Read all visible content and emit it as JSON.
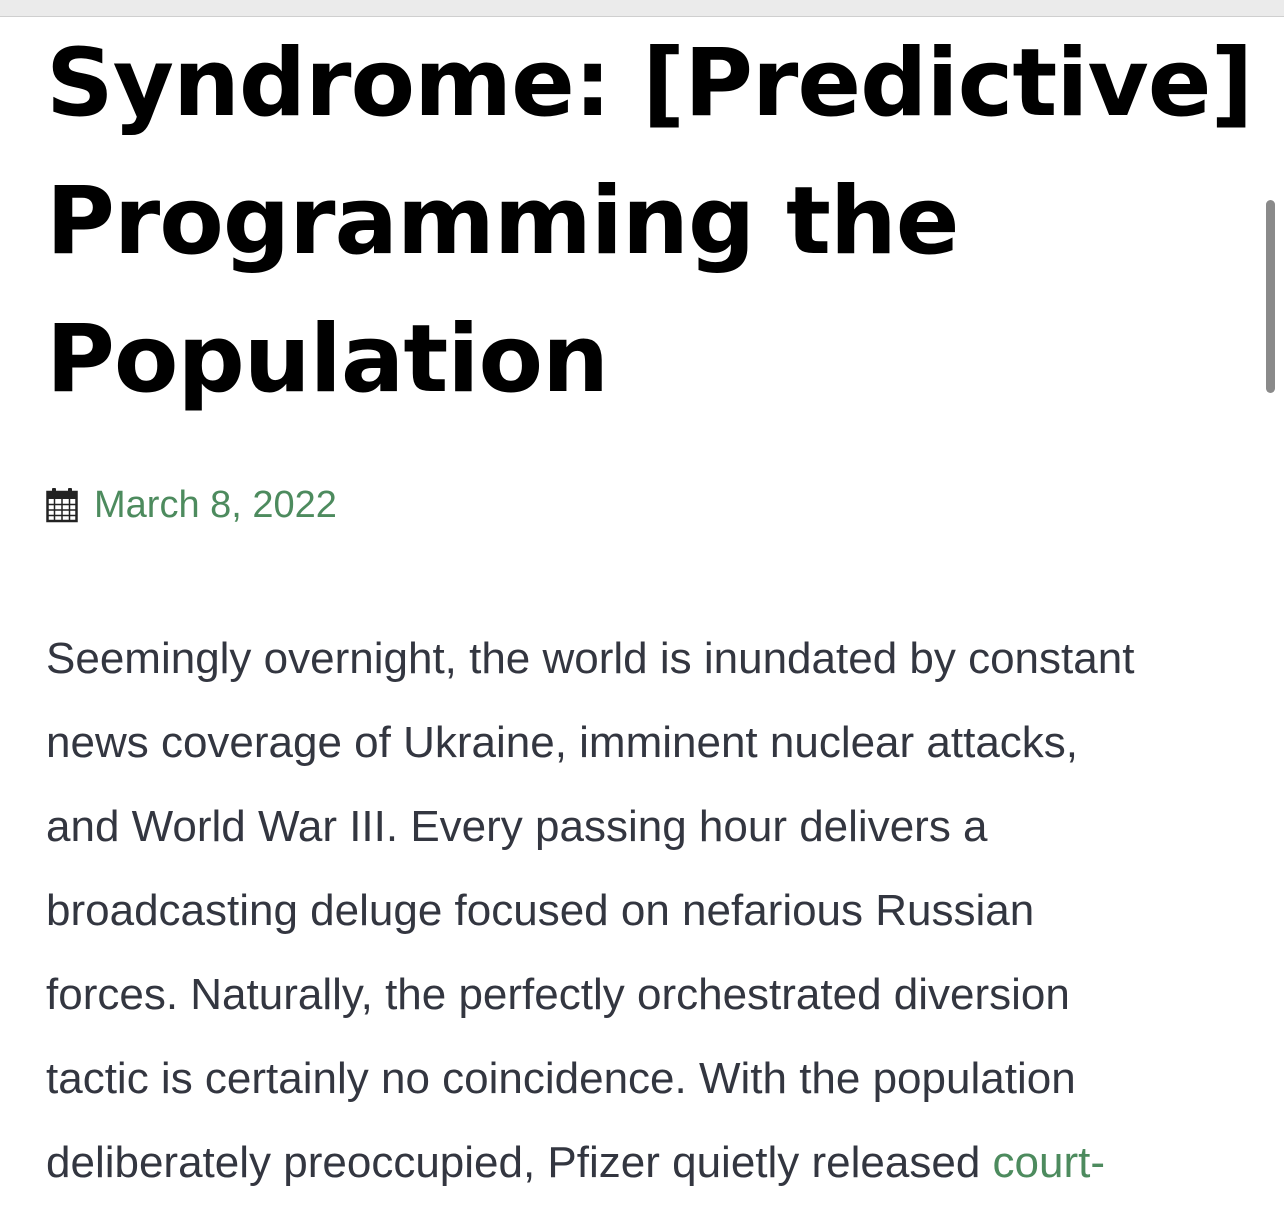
{
  "title": {
    "lines": [
      "Syndrome: [Predictive]",
      "Programming the",
      "Population"
    ]
  },
  "meta": {
    "date": "March 8, 2022",
    "icon": "calendar-icon"
  },
  "article": {
    "lines": [
      "Seemingly overnight, the world is inundated by constant",
      "news coverage of Ukraine, imminent nuclear attacks,",
      "and World War III. Every passing hour delivers a",
      "broadcasting deluge focused on nefarious Russian",
      "forces. Naturally, the perfectly orchestrated diversion",
      "tactic is certainly no coincidence. With the population",
      "deliberately preoccupied, Pfizer quietly released "
    ],
    "link_text": "court-"
  },
  "colors": {
    "link": "#4d8b5e",
    "body_text": "#333640",
    "title": "#000000"
  }
}
